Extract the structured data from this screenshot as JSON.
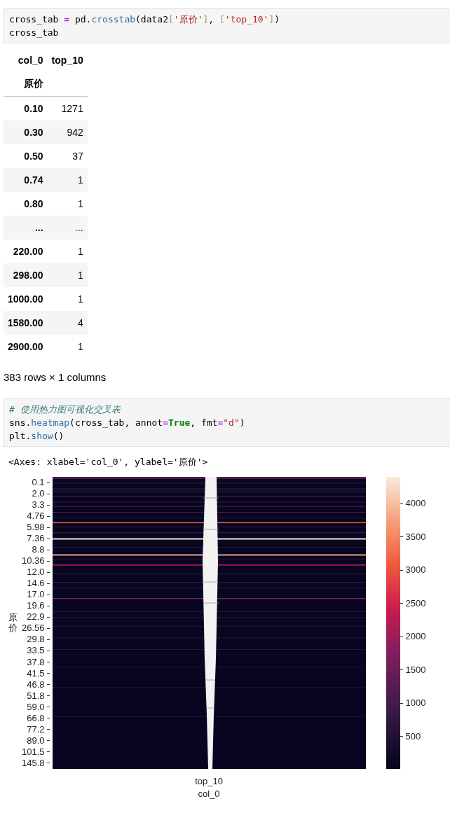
{
  "code_cell_1": {
    "lines": [
      [
        {
          "text": "cross_tab ",
          "kind": "plain"
        },
        {
          "text": "=",
          "kind": "op"
        },
        {
          "text": " pd.",
          "kind": "plain"
        },
        {
          "text": "crosstab",
          "kind": "func"
        },
        {
          "text": "(data2",
          "kind": "plain"
        },
        {
          "text": "[",
          "kind": "bracket"
        },
        {
          "text": "'原价'",
          "kind": "str"
        },
        {
          "text": "]",
          "kind": "bracket"
        },
        {
          "text": ", ",
          "kind": "plain"
        },
        {
          "text": "[",
          "kind": "bracket"
        },
        {
          "text": "'top_10'",
          "kind": "str"
        },
        {
          "text": "]",
          "kind": "bracket"
        },
        {
          "text": ")",
          "kind": "plain"
        }
      ],
      [
        {
          "text": "cross_tab",
          "kind": "plain"
        }
      ]
    ]
  },
  "table": {
    "column_header": "col_0",
    "columns": [
      "top_10"
    ],
    "index_name": "原价",
    "rows": [
      {
        "index": "0.10",
        "values": [
          "1271"
        ]
      },
      {
        "index": "0.30",
        "values": [
          "942"
        ]
      },
      {
        "index": "0.50",
        "values": [
          "37"
        ]
      },
      {
        "index": "0.74",
        "values": [
          "1"
        ]
      },
      {
        "index": "0.80",
        "values": [
          "1"
        ]
      },
      {
        "index": "...",
        "values": [
          "..."
        ]
      },
      {
        "index": "220.00",
        "values": [
          "1"
        ]
      },
      {
        "index": "298.00",
        "values": [
          "1"
        ]
      },
      {
        "index": "1000.00",
        "values": [
          "1"
        ]
      },
      {
        "index": "1580.00",
        "values": [
          "4"
        ]
      },
      {
        "index": "2900.00",
        "values": [
          "1"
        ]
      }
    ],
    "footer": "383 rows × 1 columns"
  },
  "code_cell_2": {
    "lines": [
      [
        {
          "text": "# 使用热力图可视化交叉表",
          "kind": "comment"
        }
      ],
      [
        {
          "text": "sns.",
          "kind": "plain"
        },
        {
          "text": "heatmap",
          "kind": "func"
        },
        {
          "text": "(cross_tab, annot",
          "kind": "plain"
        },
        {
          "text": "=",
          "kind": "op"
        },
        {
          "text": "True",
          "kind": "kw"
        },
        {
          "text": ", fmt",
          "kind": "plain"
        },
        {
          "text": "=",
          "kind": "op"
        },
        {
          "text": "\"d\"",
          "kind": "str"
        },
        {
          "text": ")",
          "kind": "plain"
        }
      ],
      [
        {
          "text": "plt.",
          "kind": "plain"
        },
        {
          "text": "show",
          "kind": "func"
        },
        {
          "text": "()",
          "kind": "plain"
        }
      ]
    ]
  },
  "output_text": "<Axes: xlabel='col_0', ylabel='原价'>",
  "heatmap": {
    "ylabel": "原价",
    "yticks": [
      "0.1",
      "2.0",
      "3.3",
      "4.76",
      "5.98",
      "7.36",
      "8.8",
      "10.36",
      "12.0",
      "14.6",
      "17.0",
      "19.6",
      "22.9",
      "26.56",
      "29.8",
      "33.5",
      "37.8",
      "41.5",
      "46.8",
      "51.8",
      "59.0",
      "66.8",
      "77.2",
      "89.0",
      "101.5",
      "145.8"
    ],
    "xtick": "top_10",
    "xlabel": "col_0",
    "colorbar_ticks": [
      "4000",
      "3500",
      "3000",
      "2500",
      "2000",
      "1500",
      "1000",
      "500"
    ]
  }
}
